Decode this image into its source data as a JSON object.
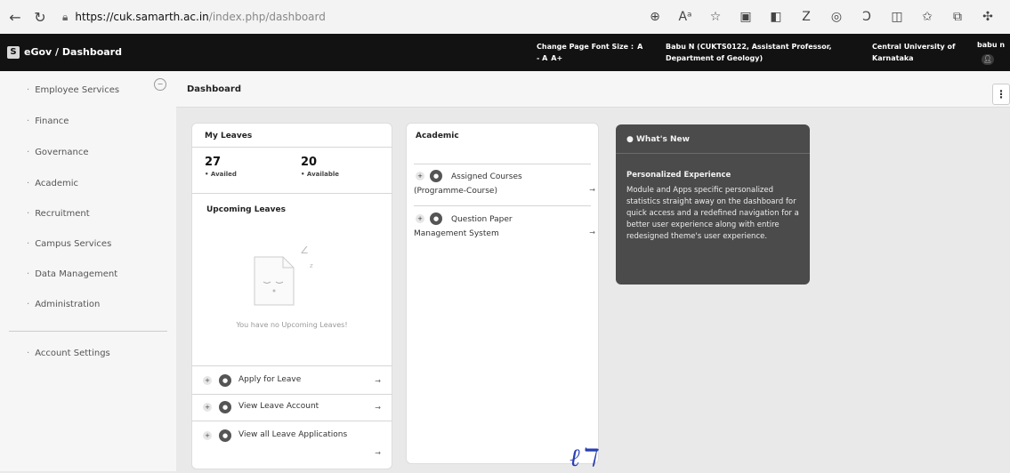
{
  "browser": {
    "url_host": "https://cuk.samarth.ac.in",
    "url_path": "/index.php/dashboard",
    "icons": [
      "zoom-icon",
      "read-aloud-icon",
      "favorite-star-icon",
      "extension-icon",
      "extension-icon",
      "z-extension-icon",
      "extension-icon",
      "extension-icon",
      "split-screen-icon",
      "favorites-icon",
      "collections-icon",
      "copilot-icon"
    ]
  },
  "header": {
    "logo": "S",
    "breadcrumb": "eGov  /  Dashboard",
    "font_size_label": "Change Page Font Size :",
    "font_a": "A",
    "font_minus": "- A",
    "font_plus": "A+",
    "user_line1": "Babu N (CUKTS0122, Assistant Professor,",
    "user_line2": "Department of Geology)",
    "univ_line1": "Central University of",
    "univ_line2": "Karnataka",
    "user_short": "babu n"
  },
  "sidebar": {
    "items": [
      {
        "label": "Employee Services"
      },
      {
        "label": "Finance"
      },
      {
        "label": "Governance"
      },
      {
        "label": "Academic"
      },
      {
        "label": "Recruitment"
      },
      {
        "label": "Campus Services"
      },
      {
        "label": "Data Management"
      },
      {
        "label": "Administration"
      }
    ],
    "account": "Account Settings"
  },
  "main": {
    "title": "Dashboard",
    "menu": "⋮"
  },
  "leaves": {
    "title": "My Leaves",
    "availed_num": "27",
    "availed_label": "• Availed",
    "available_num": "20",
    "available_label": "• Available",
    "upcoming_title": "Upcoming Leaves",
    "empty_text": "You have no Upcoming Leaves!",
    "actions": [
      "Apply for Leave",
      "View Leave Account",
      "View all Leave Applications"
    ]
  },
  "academic": {
    "title": "Academic",
    "items": [
      "Assigned Courses (Programme-Course)",
      "Question Paper Management System"
    ]
  },
  "whats_new": {
    "title": "What's New",
    "subtitle": "Personalized Experience",
    "body": "Module and Apps specific personalized statistics straight away on the dashboard for quick access and a redefined navigation for a better user experience along with entire redesigned theme's user experience."
  }
}
